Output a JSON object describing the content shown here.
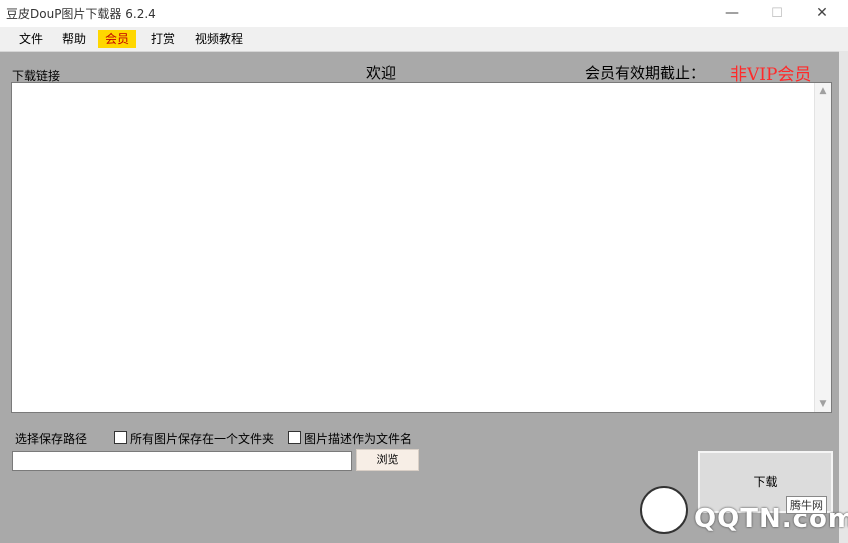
{
  "window": {
    "title": "豆皮DouP图片下载器 6.2.4",
    "minimize_glyph": "—",
    "maximize_glyph": "☐",
    "close_glyph": "✕"
  },
  "menu": {
    "items": [
      {
        "label": "文件"
      },
      {
        "label": "帮助"
      },
      {
        "label": "会员",
        "active": true
      },
      {
        "label": "打赏"
      },
      {
        "label": "视频教程"
      }
    ]
  },
  "main": {
    "links_label": "下载链接",
    "welcome": "欢迎",
    "member_label": "会员有效期截止：",
    "vip_status": "非VIP会员",
    "links_value": ""
  },
  "bottom": {
    "save_path_label": "选择保存路径",
    "single_folder_label": "所有图片保存在一个文件夹",
    "single_folder_checked": false,
    "desc_filename_label": "图片描述作为文件名",
    "desc_filename_checked": false,
    "path_value": "",
    "browse_label": "浏览",
    "download_label": "下载"
  },
  "watermark": {
    "text": "QQTN.com",
    "sub": "腾牛网"
  },
  "colors": {
    "background": "#a9a9a9",
    "active_menu_bg": "#ffd700",
    "active_menu_text": "#c00000",
    "vip_text": "#ff2a2a"
  }
}
